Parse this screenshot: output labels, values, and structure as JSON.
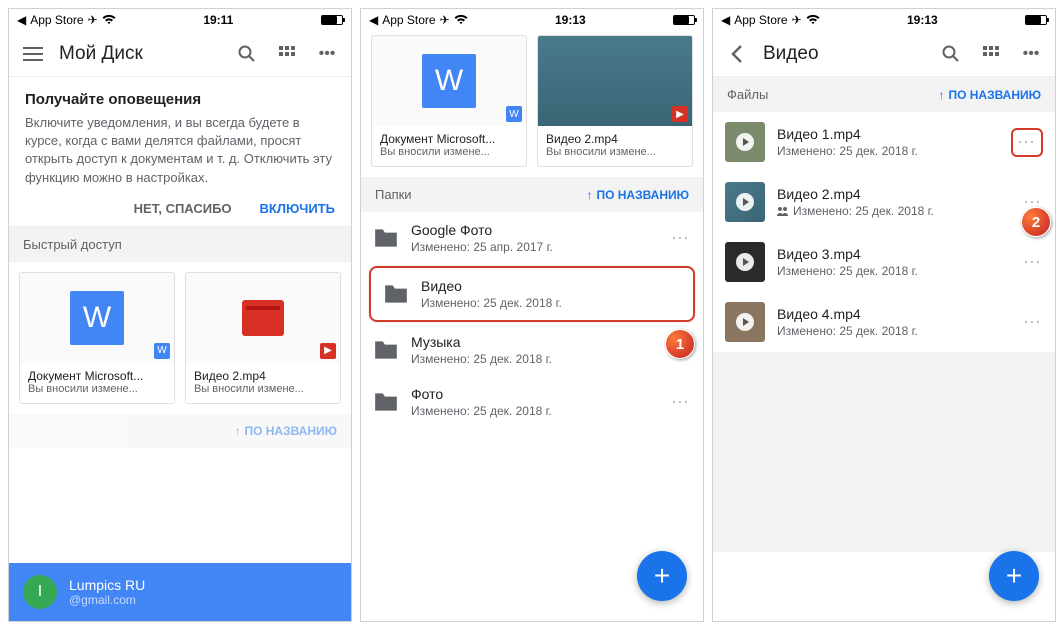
{
  "status": {
    "app_link": "App Store",
    "time1": "19:11",
    "time2": "19:13",
    "time3": "19:13"
  },
  "s1": {
    "title": "Мой Диск",
    "notif_title": "Получайте оповещения",
    "notif_body": "Включите уведомления, и вы всегда будете в курсе, когда с вами делятся файлами, просят открыть доступ к документам и т. д. Отключить эту функцию можно в настройках.",
    "action_no": "НЕТ, СПАСИБО",
    "action_yes": "ВКЛЮЧИТЬ",
    "quick_access": "Быстрый доступ",
    "card1_name": "Документ Microsoft...",
    "card1_sub": "Вы вносили измене...",
    "card2_name": "Видео 2.mp4",
    "card2_sub": "Вы вносили измене...",
    "sort_label": "ПО НАЗВАНИЮ",
    "account_name": "Lumpics RU",
    "account_email": "@gmail.com",
    "avatar_letter": "I"
  },
  "s2": {
    "card1_name": "Документ Microsoft...",
    "card1_sub": "Вы вносили измене...",
    "card2_name": "Видео 2.mp4",
    "card2_sub": "Вы вносили измене...",
    "section": "Папки",
    "sort_label": "ПО НАЗВАНИЮ",
    "f1_name": "Google Фото",
    "f1_sub": "Изменено: 25 апр. 2017 г.",
    "f2_name": "Видео",
    "f2_sub": "Изменено: 25 дек. 2018 г.",
    "f3_name": "Музыка",
    "f3_sub": "Изменено: 25 дек. 2018 г.",
    "f4_name": "Фото",
    "f4_sub": "Изменено: 25 дек. 2018 г.",
    "callout": "1"
  },
  "s3": {
    "title": "Видео",
    "section": "Файлы",
    "sort_label": "ПО НАЗВАНИЮ",
    "v1_name": "Видео 1.mp4",
    "v1_sub": "Изменено: 25 дек. 2018 г.",
    "v2_name": "Видео 2.mp4",
    "v2_sub": "Изменено: 25 дек. 2018 г.",
    "v3_name": "Видео 3.mp4",
    "v3_sub": "Изменено: 25 дек. 2018 г.",
    "v4_name": "Видео 4.mp4",
    "v4_sub": "Изменено: 25 дек. 2018 г.",
    "callout": "2"
  }
}
